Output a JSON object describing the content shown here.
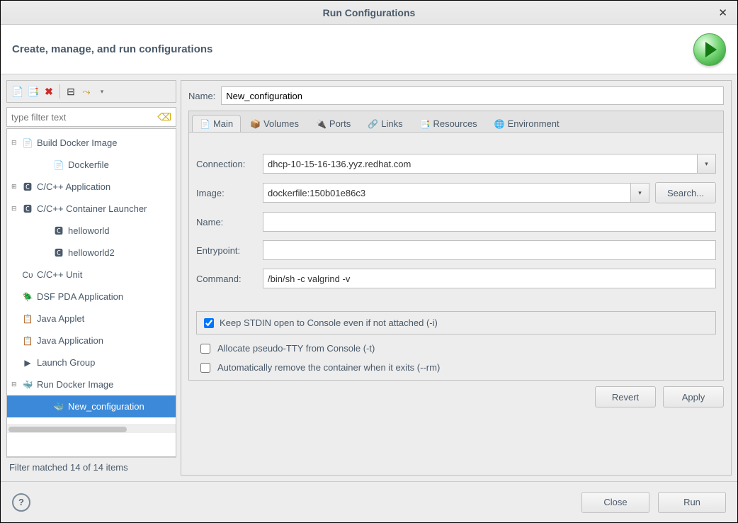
{
  "titlebar": {
    "title": "Run Configurations"
  },
  "header": {
    "subtitle": "Create, manage, and run configurations"
  },
  "sidebar": {
    "filter_placeholder": "type filter text",
    "tree": [
      {
        "label": "Build Docker Image",
        "expanded": true,
        "icon": "📄",
        "children": [
          {
            "label": "Dockerfile",
            "icon": "📄"
          }
        ]
      },
      {
        "label": "C/C++ Application",
        "icon": "🅲",
        "children": []
      },
      {
        "label": "C/C++ Container Launcher",
        "expanded": true,
        "icon": "🅲",
        "children": [
          {
            "label": "helloworld",
            "icon": "🅲"
          },
          {
            "label": "helloworld2",
            "icon": "🅲"
          }
        ]
      },
      {
        "label": "C/C++ Unit",
        "icon": "Cᴜ"
      },
      {
        "label": "DSF PDA Application",
        "icon": "🪲"
      },
      {
        "label": "Java Applet",
        "icon": "📋"
      },
      {
        "label": "Java Application",
        "icon": "📋"
      },
      {
        "label": "Launch Group",
        "icon": "▶"
      },
      {
        "label": "Run Docker Image",
        "expanded": true,
        "icon": "🐳",
        "children": [
          {
            "label": "New_configuration",
            "icon": "🐳",
            "selected": true
          }
        ]
      }
    ],
    "filter_status": "Filter matched 14 of 14 items"
  },
  "main": {
    "name_label": "Name:",
    "name_value": "New_configuration",
    "tabs": [
      {
        "label": "Main",
        "active": true,
        "icon": "📄"
      },
      {
        "label": "Volumes",
        "icon": "📦"
      },
      {
        "label": "Ports",
        "icon": "🔌"
      },
      {
        "label": "Links",
        "icon": "🔗"
      },
      {
        "label": "Resources",
        "icon": "📑"
      },
      {
        "label": "Environment",
        "icon": "🌐"
      }
    ],
    "form": {
      "connection_label": "Connection:",
      "connection_value": "dhcp-10-15-16-136.yyz.redhat.com",
      "image_label": "Image:",
      "image_value": "dockerfile:150b01e86c3",
      "search_label": "Search...",
      "container_name_label": "Name:",
      "container_name_value": "",
      "entrypoint_label": "Entrypoint:",
      "entrypoint_value": "",
      "command_label": "Command:",
      "command_value": "/bin/sh -c valgrind -v",
      "chk_stdin": "Keep STDIN open to Console even if not attached (-i)",
      "chk_tty": "Allocate pseudo-TTY from Console (-t)",
      "chk_rm": "Automatically remove the container when it exits (--rm)"
    },
    "buttons": {
      "revert": "Revert",
      "apply": "Apply"
    }
  },
  "footer": {
    "close": "Close",
    "run": "Run"
  }
}
